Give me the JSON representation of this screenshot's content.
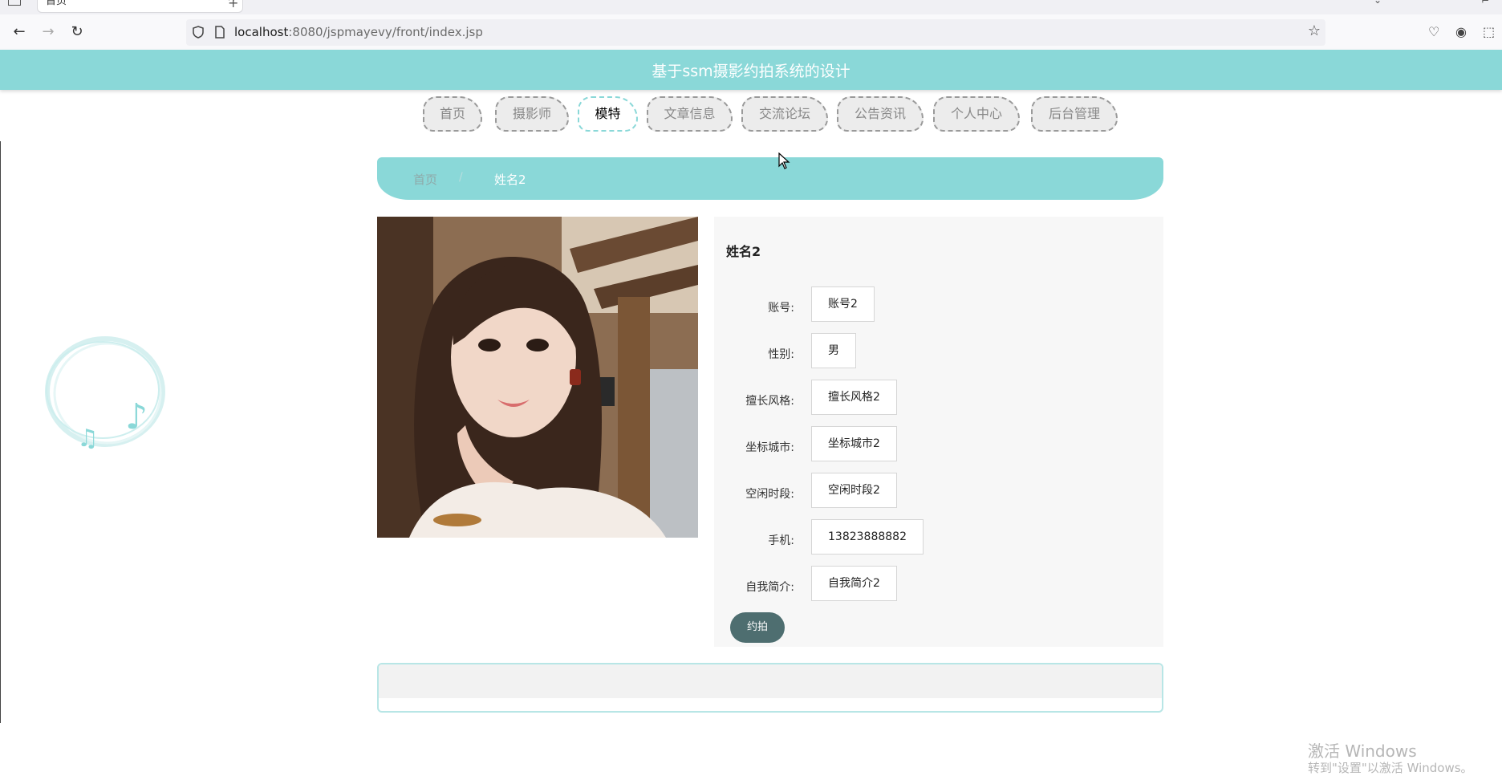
{
  "browser": {
    "tab_title": "首页",
    "tab_close": "×",
    "new_tab": "+",
    "url_host": "localhost",
    "url_path": ":8080/jspmayevy/front/index.jsp"
  },
  "site": {
    "title": "基于ssm摄影约拍系统的设计",
    "nav": [
      {
        "label": "首页",
        "active": false
      },
      {
        "label": "摄影师",
        "active": false
      },
      {
        "label": "模特",
        "active": true
      },
      {
        "label": "文章信息",
        "active": false
      },
      {
        "label": "交流论坛",
        "active": false
      },
      {
        "label": "公告资讯",
        "active": false
      },
      {
        "label": "个人中心",
        "active": false
      },
      {
        "label": "后台管理",
        "active": false
      }
    ],
    "accent_color": "#8ad8d8"
  },
  "breadcrumb": {
    "home": "首页",
    "separator": "/",
    "current": "姓名2"
  },
  "detail": {
    "name": "姓名2",
    "fields": [
      {
        "label": "账号:",
        "value": "账号2"
      },
      {
        "label": "性别:",
        "value": "男"
      },
      {
        "label": "擅长风格:",
        "value": "擅长风格2"
      },
      {
        "label": "坐标城市:",
        "value": "坐标城市2"
      },
      {
        "label": "空闲时段:",
        "value": "空闲时段2"
      },
      {
        "label": "手机:",
        "value": "13823888882"
      },
      {
        "label": "自我简介:",
        "value": "自我简介2"
      }
    ],
    "book_button": "约拍"
  },
  "watermark": {
    "line1": "激活 Windows",
    "line2": "转到\"设置\"以激活 Windows。"
  }
}
